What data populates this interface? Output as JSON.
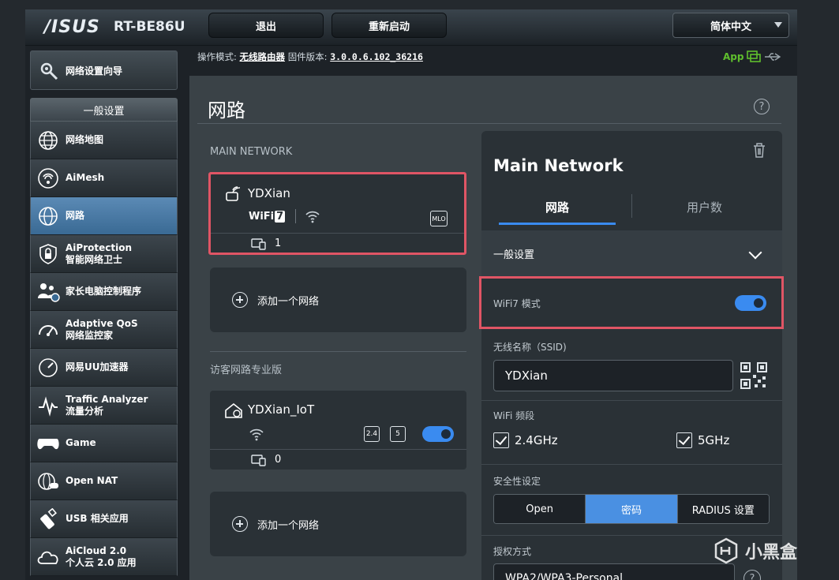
{
  "header": {
    "logo": "/ISUS",
    "model": "RT-BE86U",
    "logout_label": "退出",
    "reboot_label": "重新启动",
    "language": "简体中文"
  },
  "info": {
    "mode_label": "操作模式:",
    "mode_value": "无线路由器",
    "fw_label": "固件版本:",
    "fw_value": "3.0.0.6.102_36216",
    "app_label": "App"
  },
  "sidebar": {
    "wizard_label": "网络设置向导",
    "general_header": "一般设置",
    "items": [
      {
        "line1": "网络地图",
        "line2": ""
      },
      {
        "line1": "AiMesh",
        "line2": ""
      },
      {
        "line1": "网路",
        "line2": ""
      },
      {
        "line1": "AiProtection",
        "line2": "智能网络卫士"
      },
      {
        "line1": "家长电脑控制程序",
        "line2": ""
      },
      {
        "line1": "Adaptive QoS",
        "line2": "网络监控家"
      },
      {
        "line1": "网易UU加速器",
        "line2": ""
      },
      {
        "line1": "Traffic Analyzer",
        "line2": "流量分析"
      },
      {
        "line1": "Game",
        "line2": ""
      },
      {
        "line1": "Open NAT",
        "line2": ""
      },
      {
        "line1": "USB 相关应用",
        "line2": ""
      },
      {
        "line1": "AiCloud 2.0",
        "line2": "个人云 2.0 应用"
      }
    ]
  },
  "main": {
    "title": "网路",
    "main_network_label": "MAIN NETWORK",
    "main_net": {
      "ssid": "YDXian",
      "wifi_badge": "WiFi",
      "wifi_gen": "7",
      "mlo": "MLO",
      "clients": "1"
    },
    "add_network": "添加一个网络",
    "guest_label": "访客网路专业版",
    "iot_net": {
      "ssid": "YDXian_IoT",
      "band1": "2.4",
      "band2": "5",
      "clients": "0"
    }
  },
  "detail": {
    "title": "Main Network",
    "tab_network": "网路",
    "tab_users": "用户数",
    "section_general": "一般设置",
    "wifi7_label": "WiFi7 模式",
    "ssid_label": "无线名称（SSID)",
    "ssid_value": "YDXian",
    "band_label": "WiFi 频段",
    "band_24": "2.4GHz",
    "band_5": "5GHz",
    "security_label": "安全性设定",
    "security_options": [
      "Open",
      "密码",
      "RADIUS 设置"
    ],
    "auth_label": "授权方式",
    "auth_value": "WPA2/WPA3-Personal"
  },
  "watermark": "小黑盒",
  "colors": {
    "accent": "#3a8bf0",
    "highlight": "#e05565",
    "active_tab": "#4a90e2"
  }
}
